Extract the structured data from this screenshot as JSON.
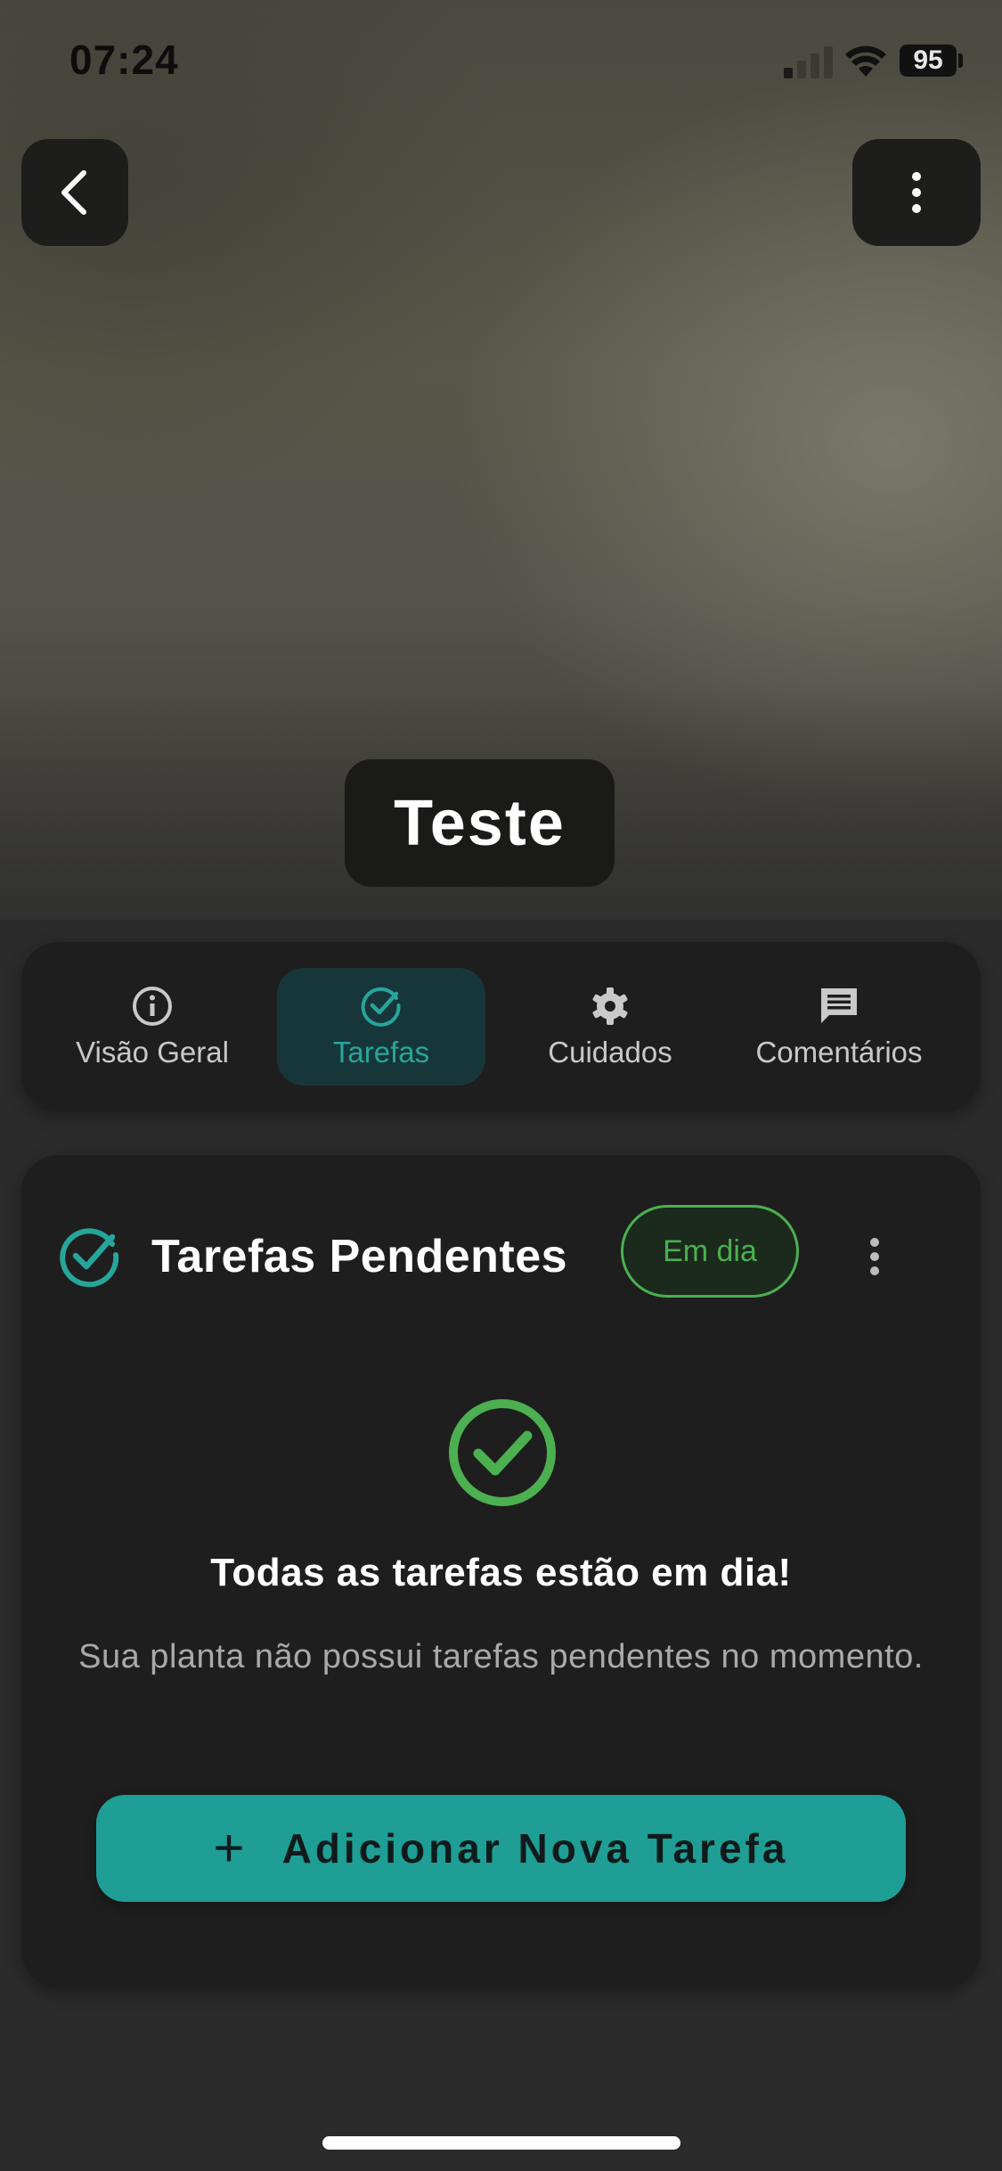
{
  "status_bar": {
    "time": "07:24",
    "battery": "95",
    "icons": [
      "signal-icon",
      "wifi-icon",
      "battery-icon"
    ]
  },
  "header": {
    "back_icon": "chevron-left-icon",
    "more_icon": "more-vertical-icon",
    "plant_name": "Teste"
  },
  "tabs": [
    {
      "label": "Visão Geral",
      "icon": "info-icon",
      "active": false
    },
    {
      "label": "Tarefas",
      "icon": "check-circle-icon",
      "active": true
    },
    {
      "label": "Cuidados",
      "icon": "gear-icon",
      "active": false
    },
    {
      "label": "Comentários",
      "icon": "comment-icon",
      "active": false
    }
  ],
  "tasks_card": {
    "title": "Tarefas Pendentes",
    "status_badge": "Em dia",
    "empty_title": "Todas as tarefas estão em dia!",
    "empty_subtitle": "Sua planta não possui tarefas pendentes no momento.",
    "add_button_label": "Adicionar Nova Tarefa"
  },
  "colors": {
    "accent": "#26a69a",
    "success": "#4caf50",
    "button": "#1e9e95",
    "background": "#2b2b2b",
    "surface": "#1e1e1e"
  }
}
